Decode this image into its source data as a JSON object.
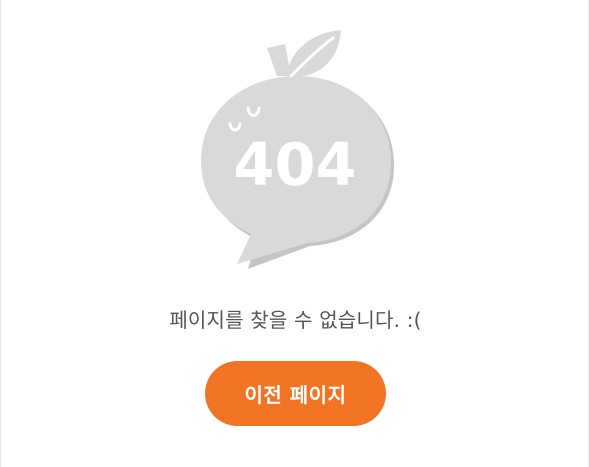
{
  "illustration": {
    "icon": "tangerine-speech-bubble",
    "code": "404",
    "fill_color": "#d9d9d9",
    "shadow_color": "#c4c4c4"
  },
  "message": "페이지를 찾을 수 없습니다. :(",
  "back_button": {
    "label": "이전 페이지",
    "color": "#f17424"
  }
}
